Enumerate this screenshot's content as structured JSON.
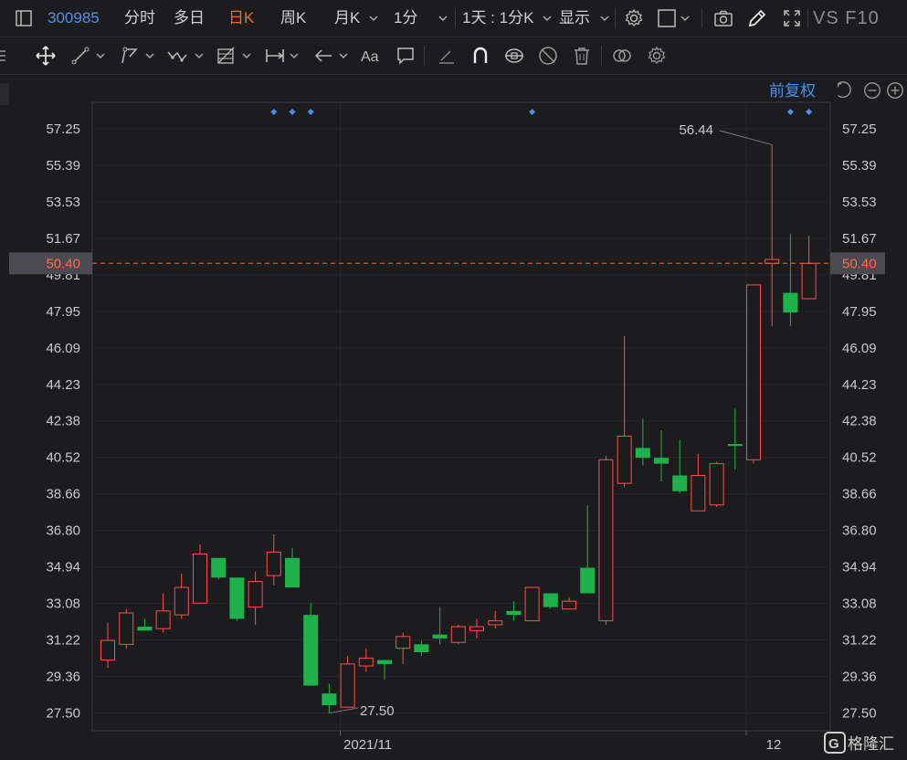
{
  "stock": {
    "code": "300985"
  },
  "periods": [
    {
      "label": "分时",
      "active": false
    },
    {
      "label": "多日",
      "active": false
    },
    {
      "label": "日K",
      "active": true
    },
    {
      "label": "周K",
      "active": false
    },
    {
      "label": "月K",
      "active": false
    },
    {
      "label": "1分",
      "active": false
    }
  ],
  "toolbar": {
    "interval_select": "1天 : 1分K",
    "display_label": "显示",
    "vs_f10": "VS F10",
    "adjust_label": "前复权"
  },
  "colors": {
    "up": "#ff4d4d",
    "down": "#1fb14b",
    "active_tab": "#f06a2a",
    "accent": "#4f8fe6",
    "price_line": "#e06a3a"
  },
  "watermark": {
    "text": "格隆汇"
  },
  "chart_data": {
    "type": "candlestick",
    "ylim": [
      26.6,
      58.6
    ],
    "y_ticks": [
      "57.25",
      "55.39",
      "53.53",
      "51.67",
      "49.81",
      "47.95",
      "46.09",
      "44.23",
      "42.38",
      "40.52",
      "38.66",
      "36.80",
      "34.94",
      "33.08",
      "31.22",
      "29.36",
      "27.50"
    ],
    "current_price": "50.40",
    "x_labels": [
      {
        "index": 13,
        "label": "2021/11"
      },
      {
        "index": 35,
        "label": "12"
      }
    ],
    "high_annotation": {
      "index": 36,
      "value": "56.44"
    },
    "low_annotation": {
      "index": 12,
      "value": "27.50"
    },
    "event_markers": [
      9,
      10,
      11,
      23,
      37,
      38
    ],
    "candles": [
      {
        "o": 30.2,
        "h": 32.1,
        "l": 29.8,
        "c": 31.2
      },
      {
        "o": 31.0,
        "h": 32.8,
        "l": 30.8,
        "c": 32.6
      },
      {
        "o": 31.9,
        "h": 32.3,
        "l": 31.7,
        "c": 31.7
      },
      {
        "o": 31.8,
        "h": 33.6,
        "l": 31.6,
        "c": 32.7
      },
      {
        "o": 32.5,
        "h": 34.6,
        "l": 32.3,
        "c": 33.9
      },
      {
        "o": 33.1,
        "h": 36.1,
        "l": 33.1,
        "c": 35.6
      },
      {
        "o": 35.4,
        "h": 35.4,
        "l": 34.3,
        "c": 34.4
      },
      {
        "o": 34.4,
        "h": 34.4,
        "l": 32.2,
        "c": 32.3
      },
      {
        "o": 32.9,
        "h": 34.7,
        "l": 32.0,
        "c": 34.2
      },
      {
        "o": 34.5,
        "h": 36.6,
        "l": 34.0,
        "c": 35.7
      },
      {
        "o": 35.4,
        "h": 35.9,
        "l": 33.9,
        "c": 33.9
      },
      {
        "o": 32.5,
        "h": 33.1,
        "l": 28.9,
        "c": 28.9
      },
      {
        "o": 28.5,
        "h": 29.0,
        "l": 27.5,
        "c": 27.9
      },
      {
        "o": 27.8,
        "h": 30.4,
        "l": 27.8,
        "c": 30.0
      },
      {
        "o": 29.9,
        "h": 30.8,
        "l": 29.6,
        "c": 30.3
      },
      {
        "o": 30.2,
        "h": 30.2,
        "l": 29.2,
        "c": 30.0
      },
      {
        "o": 30.8,
        "h": 31.6,
        "l": 30.0,
        "c": 31.4
      },
      {
        "o": 31.0,
        "h": 31.2,
        "l": 30.4,
        "c": 30.6
      },
      {
        "o": 31.5,
        "h": 32.9,
        "l": 31.0,
        "c": 31.3
      },
      {
        "o": 31.1,
        "h": 32.0,
        "l": 31.0,
        "c": 31.9
      },
      {
        "o": 31.7,
        "h": 32.3,
        "l": 31.3,
        "c": 31.9
      },
      {
        "o": 32.0,
        "h": 32.7,
        "l": 31.8,
        "c": 32.2
      },
      {
        "o": 32.7,
        "h": 33.2,
        "l": 32.2,
        "c": 32.5
      },
      {
        "o": 32.2,
        "h": 33.9,
        "l": 32.2,
        "c": 33.9
      },
      {
        "o": 33.6,
        "h": 33.6,
        "l": 32.8,
        "c": 32.9
      },
      {
        "o": 32.8,
        "h": 33.4,
        "l": 32.8,
        "c": 33.2
      },
      {
        "o": 34.9,
        "h": 38.1,
        "l": 33.6,
        "c": 33.6
      },
      {
        "o": 32.2,
        "h": 40.6,
        "l": 32.0,
        "c": 40.4
      },
      {
        "o": 39.2,
        "h": 46.7,
        "l": 39.0,
        "c": 41.6
      },
      {
        "o": 41.0,
        "h": 42.5,
        "l": 40.1,
        "c": 40.5
      },
      {
        "o": 40.5,
        "h": 41.9,
        "l": 39.3,
        "c": 40.2
      },
      {
        "o": 39.6,
        "h": 41.4,
        "l": 38.7,
        "c": 38.8
      },
      {
        "o": 37.8,
        "h": 40.7,
        "l": 37.8,
        "c": 39.6
      },
      {
        "o": 38.1,
        "h": 40.3,
        "l": 38.0,
        "c": 40.2
      },
      {
        "o": 41.2,
        "h": 43.0,
        "l": 39.9,
        "c": 41.1
      },
      {
        "o": 40.4,
        "h": 49.3,
        "l": 40.2,
        "c": 49.3
      },
      {
        "o": 50.4,
        "h": 56.44,
        "l": 47.2,
        "c": 50.6
      },
      {
        "o": 48.9,
        "h": 51.9,
        "l": 47.2,
        "c": 47.9
      },
      {
        "o": 48.6,
        "h": 51.8,
        "l": 48.6,
        "c": 50.4
      }
    ]
  }
}
